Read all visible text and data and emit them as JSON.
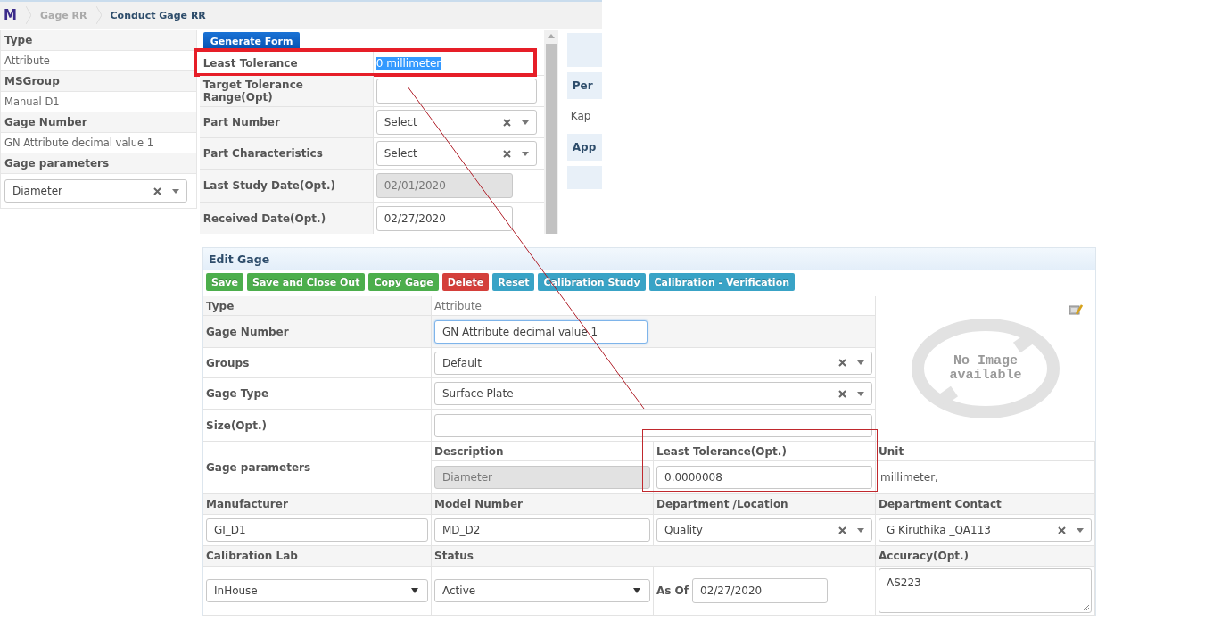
{
  "breadcrumb": {
    "logo": "M",
    "items": [
      {
        "label": "Gage RR",
        "selected": false
      },
      {
        "label": "Conduct Gage RR",
        "selected": true
      }
    ]
  },
  "summary": [
    {
      "label": "Type",
      "kind": "text",
      "value": "Attribute"
    },
    {
      "label": "MSGroup",
      "kind": "text",
      "value": "Manual D1"
    },
    {
      "label": "Gage Number",
      "kind": "text",
      "value": "GN Attribute decimal value 1"
    },
    {
      "label": "Gage parameters",
      "kind": "combobox",
      "value": "Diameter"
    }
  ],
  "conduct": {
    "generate_button": "Generate Form",
    "rows": [
      {
        "label": "Least Tolerance",
        "kind": "text",
        "value": "0 millimeter",
        "text_selected": true,
        "highlighted": true,
        "disabled": false
      },
      {
        "label": "Target Tolerance Range(Opt)",
        "kind": "input",
        "text_selected": false,
        "highlighted": false,
        "disabled": false
      },
      {
        "label": "Part Number",
        "kind": "combobox",
        "value": "Select",
        "text_selected": false,
        "highlighted": false,
        "disabled": false
      },
      {
        "label": "Part Characteristics",
        "kind": "combobox",
        "value": "Select",
        "text_selected": false,
        "highlighted": false,
        "disabled": false
      },
      {
        "label": "Last Study Date(Opt.)",
        "kind": "date",
        "value": "02/01/2020",
        "text_selected": false,
        "highlighted": false,
        "disabled": true
      },
      {
        "label": "Received Date(Opt.)",
        "kind": "date",
        "value": "02/27/2020",
        "text_selected": false,
        "highlighted": false,
        "disabled": false
      }
    ]
  },
  "side_panel": [
    {
      "kind": "header",
      "text": "Per"
    },
    {
      "kind": "text",
      "text": "Kap"
    },
    {
      "kind": "header",
      "text": "App"
    }
  ],
  "edit_gage": {
    "title": "Edit Gage",
    "buttons": [
      {
        "label": "Save",
        "color": "#4cae4c"
      },
      {
        "label": "Save and Close Out",
        "color": "#4cae4c"
      },
      {
        "label": "Copy Gage",
        "color": "#4cae4c"
      },
      {
        "label": "Delete",
        "color": "#d43f3a"
      },
      {
        "label": "Reset",
        "color": "#39a3c6"
      },
      {
        "label": "Calibration Study",
        "color": "#39a3c6"
      },
      {
        "label": "Calibration - Verification",
        "color": "#39a3c6"
      }
    ],
    "type": {
      "label": "Type",
      "kind": "text",
      "value": "Attribute"
    },
    "gage_number": {
      "label": "Gage Number",
      "kind": "input",
      "value": "GN Attribute decimal value 1",
      "focused": true
    },
    "groups": {
      "label": "Groups",
      "kind": "combobox",
      "value": "Default"
    },
    "gage_type": {
      "label": "Gage Type",
      "kind": "combobox",
      "value": "Surface Plate"
    },
    "size": {
      "label": "Size(Opt.)",
      "kind": "input"
    },
    "image_placeholder": "No Image available",
    "gage_parameters": {
      "label": "Gage parameters",
      "description_label": "Description",
      "tolerance_label": "Least Tolerance(Opt.)",
      "unit_label": "Unit",
      "description": "Diameter",
      "least_tolerance": "0.0000008",
      "unit": "millimeter,",
      "highlighted": true
    },
    "manufacturer": {
      "label": "Manufacturer",
      "kind": "input",
      "value": "GI_D1"
    },
    "model_number": {
      "label": "Model Number",
      "kind": "input",
      "value": "MD_D2"
    },
    "department_location": {
      "label": "Department /Location",
      "kind": "combobox",
      "value": "Quality"
    },
    "department_contact": {
      "label": "Department Contact",
      "kind": "combobox",
      "value": "G Kiruthika _QA113"
    },
    "calibration_lab": {
      "label": "Calibration Lab",
      "kind": "dropdown",
      "value": "InHouse"
    },
    "status": {
      "label": "Status",
      "kind": "dropdown",
      "value": "Active"
    },
    "as_of": {
      "label": "As Of",
      "kind": "date",
      "value": "02/27/2020"
    },
    "accuracy": {
      "label": "Accuracy(Opt.)",
      "kind": "textarea",
      "value": "AS223"
    }
  }
}
